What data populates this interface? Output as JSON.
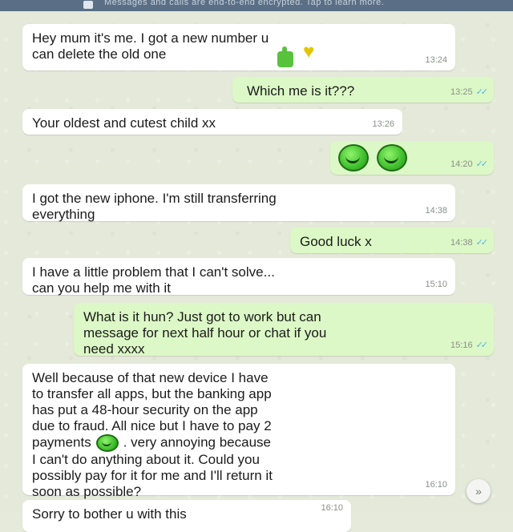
{
  "header": {
    "notice": "Messages and calls are end-to-end encrypted. Tap to learn more."
  },
  "messages": [
    {
      "dir": "in",
      "text": "Hey mum it's me. I got a new number u\ncan delete the old one",
      "time": "13:24",
      "emoji": "thumb-heart"
    },
    {
      "dir": "out",
      "text": "Which me is it???",
      "time": "13:25"
    },
    {
      "dir": "in",
      "text": "Your oldest and cutest child xx",
      "time": "13:26"
    },
    {
      "dir": "out",
      "text": "",
      "time": "14:20",
      "emoji": "two-smiles"
    },
    {
      "dir": "in",
      "text": "I got the new iphone. I'm still transferring\neverything",
      "time": "14:38"
    },
    {
      "dir": "out",
      "text": "Good luck x",
      "time": "14:38"
    },
    {
      "dir": "in",
      "text": "I have a little problem that I can't solve...\ncan you help me with it",
      "time": "15:10"
    },
    {
      "dir": "out",
      "text": "What is it hun? Just got to work but can\nmessage for next half hour or chat if you\nneed xxxx",
      "time": "15:16"
    },
    {
      "dir": "in",
      "text": "Well because of that new device I have\nto transfer all apps, but the banking app\nhas put a 48-hour security on the app\ndue to fraud. All nice but I have to pay 2\npayments",
      "text2": ". very annoying because\nI can't do anything about it. Could you\npossibly pay for it for me and I'll return it\nsoon as possible?",
      "time": "16:10"
    },
    {
      "dir": "in",
      "text": "Sorry to bother u with this",
      "time": "16:10"
    }
  ],
  "scroll_button": {
    "icon": "double-chevron-down-icon",
    "label": "»"
  }
}
